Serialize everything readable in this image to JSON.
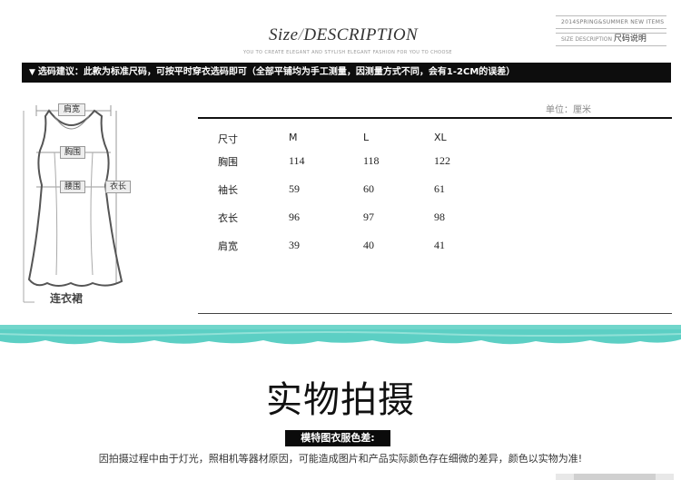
{
  "header": {
    "title_a": "Size",
    "title_slash": "/",
    "title_b": "DESCRIPTION",
    "subtitle": "YOU TO CREATE ELEGANT AND STYLISH ELEGANT FASHION FOR YOU TO CHOOSE"
  },
  "tag": {
    "line1": "2014SPRING&SUMMER NEW ITEMS",
    "line2_en": "SIZE DESCRIPTION",
    "line2_cn": "尺码说明"
  },
  "notice": {
    "arrow": "▼",
    "text": "选码建议：此款为标准尺码，可按平时穿衣选码即可（全部平铺均为手工测量，因测量方式不同，会有1-2CM的误差）"
  },
  "unit_label": "单位：厘米",
  "table": {
    "headers": [
      "尺寸",
      "M",
      "L",
      "XL"
    ],
    "rows": [
      [
        "胸围",
        "114",
        "118",
        "122"
      ],
      [
        "袖长",
        "59",
        "60",
        "61"
      ],
      [
        "衣长",
        "96",
        "97",
        "98"
      ],
      [
        "肩宽",
        "39",
        "40",
        "41"
      ]
    ]
  },
  "dress": {
    "shoulder_label": "肩宽",
    "bust_label": "胸围",
    "waist_label": "腰围",
    "length_label": "衣长",
    "caption": "连衣裙"
  },
  "photo_section": {
    "title": "实物拍摄",
    "tag": "模特图衣服色差:",
    "note": "因拍摄过程中由于灯光，照相机等器材原因，可能造成图片和产品实际颜色存在细微的差异，颜色以实物为准!"
  },
  "colors": {
    "teal": "#5ccfc4",
    "black_bar": "#0d0d0d"
  }
}
